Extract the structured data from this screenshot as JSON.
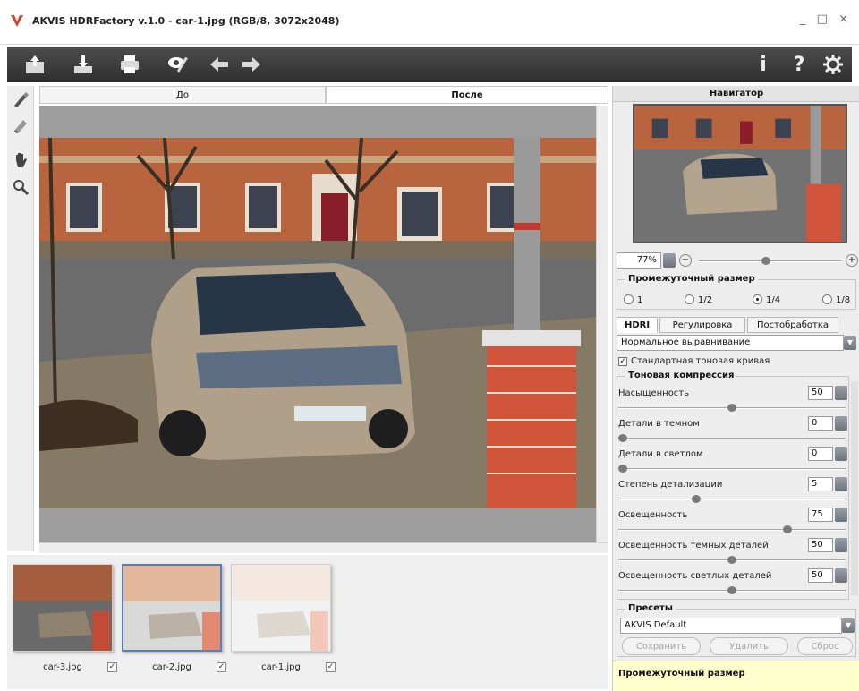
{
  "app": {
    "title": "AKVIS HDRFactory v.1.0 - car-1.jpg (RGB/8, 3072x2048)",
    "window_controls": "_ □ ×"
  },
  "toolbar": {
    "icons": [
      "open-icon",
      "save-icon",
      "print-icon",
      "share-icon",
      "undo-icon",
      "redo-icon",
      "info-icon",
      "help-icon",
      "settings-icon"
    ],
    "info_label": "i",
    "help_label": "?"
  },
  "tabs": {
    "before": "До",
    "after": "После"
  },
  "filmstrip": {
    "items": [
      {
        "label": "car-3.jpg",
        "checked": "✓"
      },
      {
        "label": "car-2.jpg",
        "checked": "✓"
      },
      {
        "label": "car-1.jpg",
        "checked": "✓"
      }
    ]
  },
  "panel": {
    "navigator_title": "Навигатор",
    "zoom": "77%",
    "intermediate_size": {
      "title": "Промежуточный размер",
      "options": [
        "1",
        "1/2",
        "1/4",
        "1/8"
      ],
      "selected": "1/4"
    },
    "tabs": [
      "HDRI",
      "Регулировка",
      "Постобработка"
    ],
    "mode": "Нормальное выравнивание",
    "standard_curve": "Стандартная тоновая кривая",
    "tone_compression": {
      "title": "Тоновая компрессия",
      "params": [
        {
          "label": "Насыщенность",
          "value": "50",
          "level": 0.5
        },
        {
          "label": "Детали в темном",
          "value": "0",
          "level": 0.0
        },
        {
          "label": "Детали в светлом",
          "value": "0",
          "level": 0.0
        },
        {
          "label": "Степень детализации",
          "value": "5",
          "level": 0.33
        },
        {
          "label": "Освещенность",
          "value": "75",
          "level": 0.75
        },
        {
          "label": "Освещенность темных деталей",
          "value": "50",
          "level": 0.5
        },
        {
          "label": "Освещенность светлых деталей",
          "value": "50",
          "level": 0.5
        }
      ]
    },
    "presets": {
      "title": "Пресеты",
      "selected": "AKVIS Default",
      "buttons": [
        "Сохранить",
        "Удалить",
        "Сброс"
      ]
    },
    "hint": "Промежуточный размер"
  },
  "colors": {
    "toolbar_bg": "#3c3c3c",
    "selection": "#5a7fb3",
    "hint_bg": "#ffffcc"
  }
}
